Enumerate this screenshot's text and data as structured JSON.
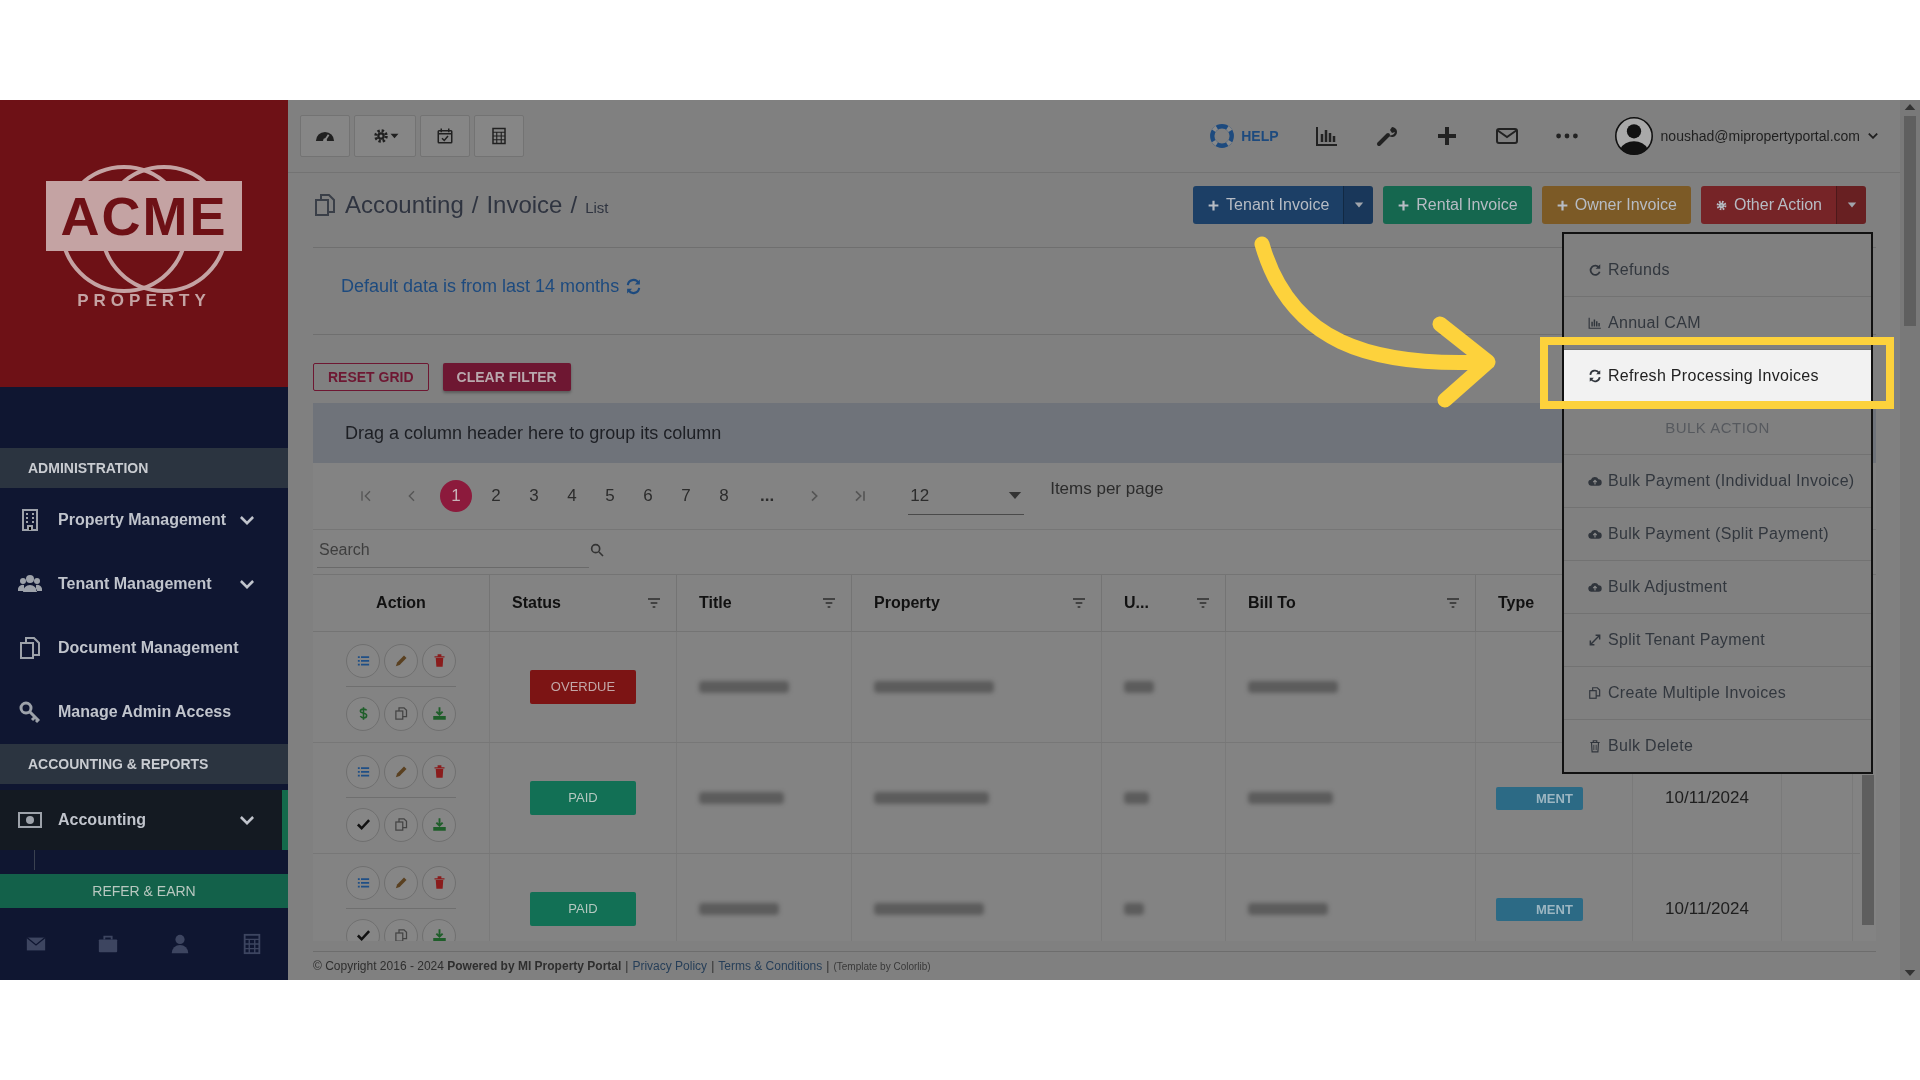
{
  "sidebar": {
    "logo": {
      "word": "ACME",
      "subtitle": "PROPERTY"
    },
    "sections": [
      {
        "title": "ADMINISTRATION",
        "items": [
          {
            "label": "Property Management",
            "expandable": true,
            "active": false
          },
          {
            "label": "Tenant Management",
            "expandable": true,
            "active": false
          },
          {
            "label": "Document Management",
            "expandable": false,
            "active": false
          },
          {
            "label": "Manage Admin Access",
            "expandable": false,
            "active": false
          }
        ]
      },
      {
        "title": "ACCOUNTING & REPORTS",
        "items": [
          {
            "label": "Accounting",
            "expandable": true,
            "active": true
          }
        ]
      }
    ],
    "refer_button": "REFER & EARN"
  },
  "top_bar": {
    "help": "HELP",
    "user_email": "noushad@mipropertyportal.com"
  },
  "breadcrumb": [
    {
      "text": "Accounting",
      "kind": "crumb"
    },
    {
      "text": "/",
      "kind": "sep"
    },
    {
      "text": "Invoice",
      "kind": "crumb"
    },
    {
      "text": "/",
      "kind": "sep"
    },
    {
      "text": "List",
      "kind": "current"
    }
  ],
  "action_buttons": [
    {
      "label": "Tenant Invoice",
      "color": "#1c3f66",
      "split": true
    },
    {
      "label": "Rental Invoice",
      "color": "#15674f",
      "split": false
    },
    {
      "label": "Owner Invoice",
      "color": "#7c5a26",
      "split": false
    },
    {
      "label": "Other Action",
      "color": "#762427",
      "split": true
    }
  ],
  "notice": "Default data is from last 14 months",
  "grid_buttons": [
    {
      "label": "RESET GRID",
      "kind": "outline"
    },
    {
      "label": "CLEAR FILTER",
      "kind": "filled"
    }
  ],
  "group_panel": "Drag a column header here to group its column",
  "pager": {
    "pages": [
      {
        "label": "1",
        "selected": true
      },
      {
        "label": "2",
        "selected": false
      },
      {
        "label": "3",
        "selected": false
      },
      {
        "label": "4",
        "selected": false
      },
      {
        "label": "5",
        "selected": false
      },
      {
        "label": "6",
        "selected": false
      },
      {
        "label": "7",
        "selected": false
      },
      {
        "label": "8",
        "selected": false
      }
    ],
    "ellipsis": "...",
    "page_size": "12",
    "page_size_label": "Items per page"
  },
  "search": {
    "placeholder": "Search"
  },
  "table": {
    "columns": [
      {
        "label": "Action",
        "filter": false
      },
      {
        "label": "Status",
        "filter": true
      },
      {
        "label": "Title",
        "filter": true
      },
      {
        "label": "Property",
        "filter": true
      },
      {
        "label": "U...",
        "filter": true
      },
      {
        "label": "Bill To",
        "filter": true
      },
      {
        "label": "Type",
        "filter": false
      }
    ],
    "rows": [
      {
        "kind": "overdue",
        "status": "OVERDUE"
      },
      {
        "kind": "paid",
        "status": "PAID",
        "type": "MENT",
        "column_7": "10/11/2024"
      },
      {
        "kind": "paid",
        "status": "PAID",
        "type": "MENT",
        "column_7": "10/11/2024"
      }
    ]
  },
  "dropdown": {
    "items": [
      {
        "label": "Refunds",
        "kind": "item",
        "selected": false
      },
      {
        "label": "Annual CAM",
        "kind": "item",
        "selected": false
      },
      {
        "label": "Refresh Processing Invoices",
        "kind": "item",
        "selected": true
      },
      {
        "label": "BULK ACTION",
        "kind": "header",
        "selected": false
      },
      {
        "label": "Bulk Payment (Individual Invoice)",
        "kind": "item",
        "selected": false
      },
      {
        "label": "Bulk Payment (Split Payment)",
        "kind": "item",
        "selected": false
      },
      {
        "label": "Bulk Adjustment",
        "kind": "item",
        "selected": false
      },
      {
        "label": "Split Tenant Payment",
        "kind": "item",
        "selected": false
      },
      {
        "label": "Create Multiple Invoices",
        "kind": "item",
        "selected": false
      },
      {
        "label": "Bulk Delete",
        "kind": "item",
        "selected": false
      }
    ]
  },
  "footer": [
    {
      "text": "© Copyright 2016 - 2024 **Powered by MI Property Portal**",
      "kind": "text"
    },
    {
      "text": "|",
      "kind": "sep"
    },
    {
      "text": "Privacy Policy",
      "kind": "link"
    },
    {
      "text": "|",
      "kind": "sep"
    },
    {
      "text": "Terms & Conditions",
      "kind": "link"
    },
    {
      "text": "|",
      "kind": "sep"
    },
    {
      "text": "(Template by Colorlib)",
      "kind": "small"
    }
  ]
}
